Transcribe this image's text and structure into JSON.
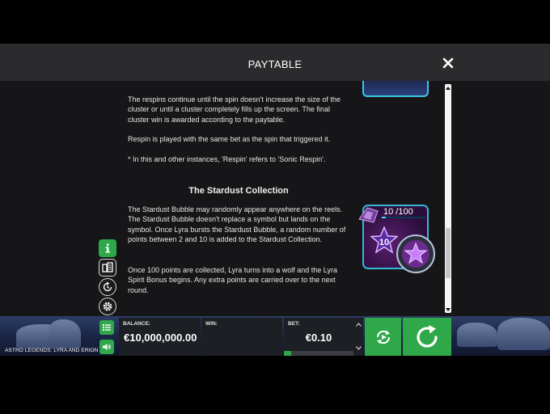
{
  "header": {
    "title": "PAYTABLE",
    "close_icon": "close-icon"
  },
  "content": {
    "paragraphs_top": [
      "The respins continue until the spin doesn't increase the size of the cluster or until a cluster completely fills up the screen. The final cluster win is awarded according to the paytable.",
      "Respin is played with the same bet as the spin that triggered it.",
      "* In this and other instances, 'Respin' refers to 'Sonic Respin'."
    ],
    "section_heading": "The Stardust Collection",
    "paragraphs_section": [
      "The Stardust Bubble may randomly appear anywhere on the reels. The Stardust Bubble doesn't replace a symbol but lands on the symbol. Once Lyra bursts the Stardust Bubble, a random number of points between 2 and 10 is added to the Stardust Collection.",
      "Once 100 points are collected, Lyra turns into a wolf and the Lyra Spirit Bonus begins. Any extra points are carried over to the next round."
    ],
    "illustration": {
      "points_label": "10 /100",
      "points_fraction": 0.1,
      "star_badge_value": "10"
    }
  },
  "side_tools": {
    "icons": [
      "info-icon",
      "paytable-icon",
      "history-icon",
      "settings-icon"
    ]
  },
  "bottom_bar": {
    "game_name": "ASTRO LEGENDS: LYRA AND ERION",
    "balance_label": "BALANCE:",
    "balance_value": "€10,000,000.00",
    "win_label": "WIN:",
    "bet_label": "BET:",
    "bet_value": "€0.10",
    "bet_level_fraction": 0.1
  },
  "colors": {
    "accent_green": "#2fa84a",
    "accent_cyan": "#38c9e6",
    "overlay_bg": "#161618",
    "header_bg": "#2b2b2e"
  }
}
